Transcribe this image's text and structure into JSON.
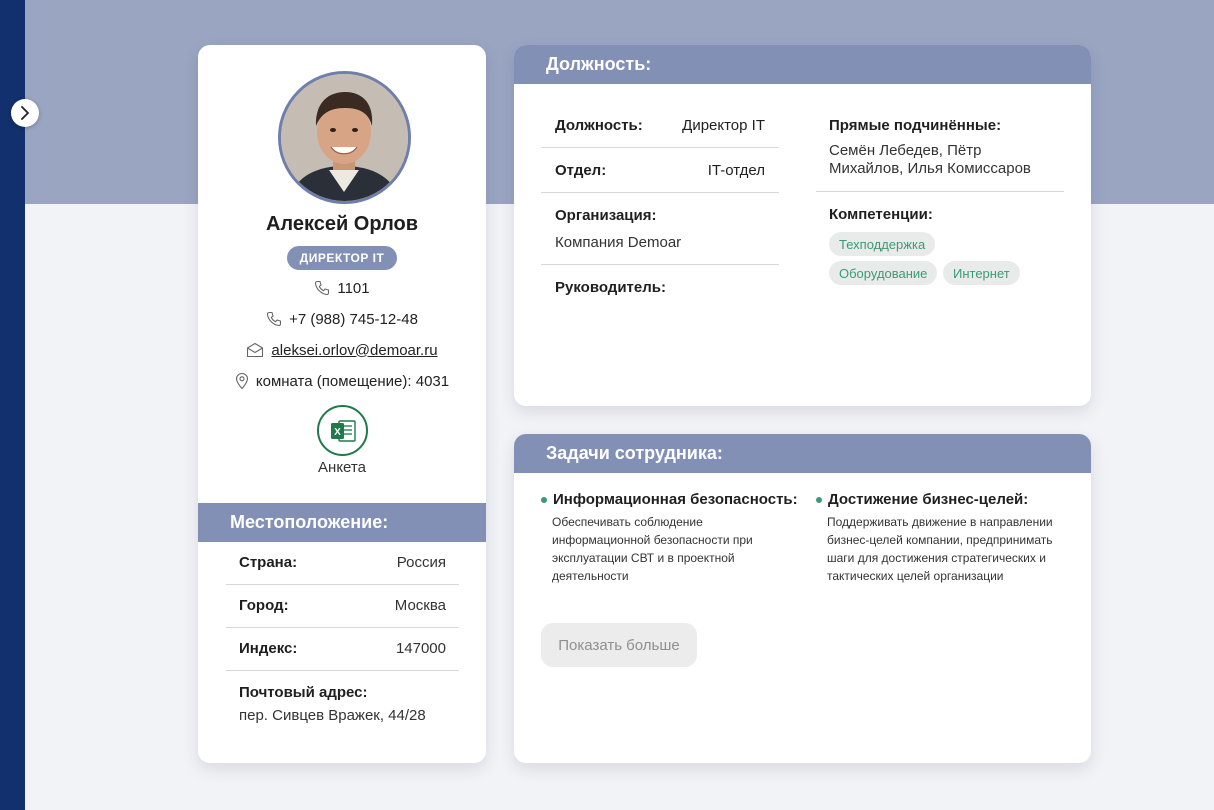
{
  "profile": {
    "name": "Алексей Орлов",
    "role": "ДИРЕКТОР IT",
    "ext": "1101",
    "phone": "+7 (988) 745-12-48",
    "email": "aleksei.orlov@demoar.ru",
    "room": "комната (помещение): 4031",
    "form_label": "Анкета"
  },
  "location": {
    "title": "Местоположение:",
    "country_label": "Страна:",
    "country": "Россия",
    "city_label": "Город:",
    "city": "Москва",
    "index_label": "Индекс:",
    "index": "147000",
    "address_label": "Почтовый адрес:",
    "address": "пер. Сивцев Вражек, 44/28"
  },
  "position": {
    "title": "Должность:",
    "job_label": "Должность:",
    "job": "Директор IT",
    "dept_label": "Отдел:",
    "dept": "IT-отдел",
    "org_label": "Организация:",
    "org": "Компания Demoar",
    "manager_label": "Руководитель:",
    "subordinates_label": "Прямые подчинённые:",
    "subordinates_line1": "Семён Лебедев, Пётр",
    "subordinates_line2": "Михайлов, Илья Комиссаров",
    "competencies_label": "Компетенции:",
    "competencies": [
      "Техподдержка",
      "Оборудование",
      "Интернет"
    ]
  },
  "tasks": {
    "title": "Задачи сотрудника:",
    "items": [
      {
        "title": "Информационная безопасность:",
        "lines": [
          "Обеспечивать соблюдение",
          "информационной безопасности при",
          "эксплуатации СВТ и в проектной",
          "деятельности"
        ]
      },
      {
        "title": "Достижение бизнес-целей:",
        "lines": [
          "Поддерживать движение в направлении",
          "бизнес-целей компании, предпринимать",
          "шаги для достижения стратегических и",
          "тактических целей организации"
        ]
      }
    ],
    "more_label": "Показать больше"
  },
  "colors": {
    "rail": "#13306e",
    "header_band": "#9aa5c2",
    "section_header": "#8390b6",
    "accent_green": "#3c9a72",
    "excel_green": "#1e7a4c"
  },
  "icons": {
    "toggle": "chevron-right-icon",
    "ext": "phone-icon",
    "phone": "phone-icon",
    "email": "envelope-icon",
    "room": "location-pin-icon",
    "form": "excel-icon"
  }
}
